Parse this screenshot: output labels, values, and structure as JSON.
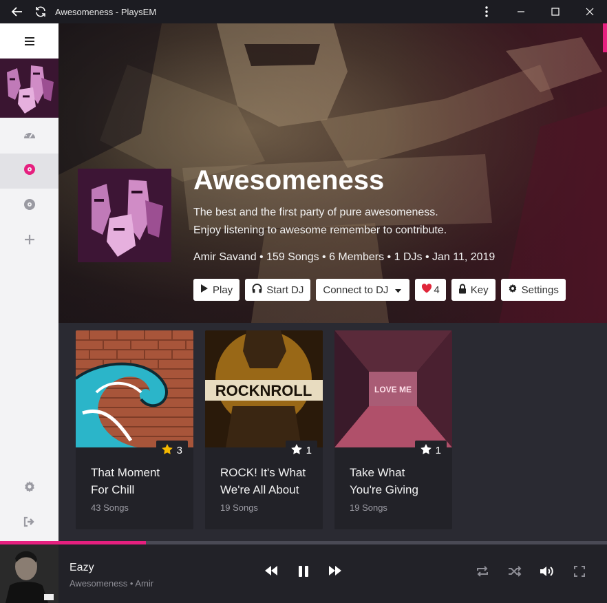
{
  "window": {
    "title": "Awesomeness - PlaysEM",
    "controls": [
      "back-icon",
      "refresh-icon",
      "more-vertical-icon",
      "minimize-icon",
      "maximize-icon",
      "close-icon"
    ]
  },
  "sidebar": {
    "menu_icon": "hamburger-icon",
    "items": [
      {
        "name": "dashboard",
        "icon": "speedometer-icon",
        "active": false
      },
      {
        "name": "parties",
        "icon": "disc-icon",
        "active": true
      },
      {
        "name": "albums",
        "icon": "vinyl-icon",
        "active": false
      },
      {
        "name": "add",
        "icon": "plus-icon",
        "active": false
      }
    ],
    "bottom": [
      {
        "name": "settings",
        "icon": "gear-icon"
      },
      {
        "name": "logout",
        "icon": "sign-out-icon"
      }
    ]
  },
  "party": {
    "title": "Awesomeness",
    "description_line1": "The best and the first party of pure awesomeness.",
    "description_line2": "Enjoy listening to awesome remember to contribute.",
    "meta": "Amir Savand • 159 Songs • 6 Members • 1 DJs • Jan 11, 2019",
    "buttons": {
      "play": "Play",
      "start_dj": "Start DJ",
      "connect_dj": "Connect to DJ",
      "likes": "4",
      "key": "Key",
      "settings": "Settings"
    }
  },
  "playlists": [
    {
      "title_line1": "That Moment",
      "title_line2": "For Chill",
      "songs": "43 Songs",
      "rating": "3",
      "star_color": "#f5b800"
    },
    {
      "title_line1": "ROCK! It's What",
      "title_line2": "We're All About",
      "songs": "19 Songs",
      "rating": "1",
      "star_color": "#ffffff"
    },
    {
      "title_line1": "Take What",
      "title_line2": "You're Giving",
      "songs": "19 Songs",
      "rating": "1",
      "star_color": "#ffffff"
    }
  ],
  "album_art_text": {
    "rock_n_roll": "ROCKNROLL",
    "love_me": "LOVE ME"
  },
  "now_playing": {
    "title": "Eazy",
    "subtitle": "Awesomeness • Amir",
    "progress_fraction": 0.24
  },
  "colors": {
    "accent": "#e6207f",
    "heart": "#e0263a"
  }
}
